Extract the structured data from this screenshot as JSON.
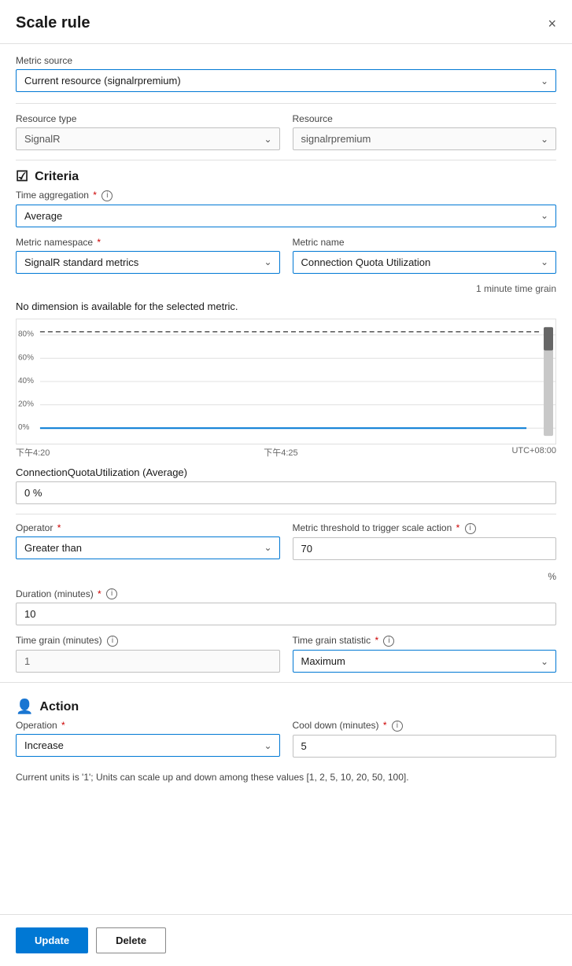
{
  "header": {
    "title": "Scale rule",
    "close_label": "×"
  },
  "metric_source": {
    "label": "Metric source",
    "value": "Current resource (signalrpremium)"
  },
  "resource_type": {
    "label": "Resource type",
    "value": "SignalR"
  },
  "resource": {
    "label": "Resource",
    "value": "signalrpremium"
  },
  "criteria": {
    "title": "Criteria"
  },
  "time_aggregation": {
    "label": "Time aggregation",
    "required": true,
    "value": "Average"
  },
  "metric_namespace": {
    "label": "Metric namespace",
    "required": true,
    "value": "SignalR standard metrics"
  },
  "metric_name": {
    "label": "Metric name",
    "value": "Connection Quota Utilization"
  },
  "time_grain_note": "1 minute time grain",
  "no_dimension_msg": "No dimension is available for the selected metric.",
  "chart": {
    "time_labels": [
      "下午4:20",
      "下午4:25",
      "UTC+08:00"
    ],
    "y_labels": [
      "80%",
      "60%",
      "40%",
      "20%",
      "0%"
    ],
    "threshold_pct": 80,
    "dashed_y_pct": 82
  },
  "metric_display": {
    "label": "ConnectionQuotaUtilization (Average)",
    "value": "0 %"
  },
  "operator": {
    "label": "Operator",
    "required": true,
    "value": "Greater than"
  },
  "metric_threshold": {
    "label": "Metric threshold to trigger scale action",
    "required": true,
    "info": true,
    "value": "70",
    "unit": "%"
  },
  "duration": {
    "label": "Duration (minutes)",
    "required": true,
    "info": true,
    "value": "10"
  },
  "time_grain_minutes": {
    "label": "Time grain (minutes)",
    "info": true,
    "value": "1"
  },
  "time_grain_statistic": {
    "label": "Time grain statistic",
    "required": true,
    "info": true,
    "value": "Maximum"
  },
  "action": {
    "title": "Action"
  },
  "operation": {
    "label": "Operation",
    "required": true,
    "value": "Increase"
  },
  "cool_down": {
    "label": "Cool down (minutes)",
    "required": true,
    "info": true,
    "value": "5"
  },
  "units_note": "Current units is '1'; Units can scale up and down among these values [1, 2, 5, 10, 20, 50, 100].",
  "buttons": {
    "update": "Update",
    "delete": "Delete"
  }
}
